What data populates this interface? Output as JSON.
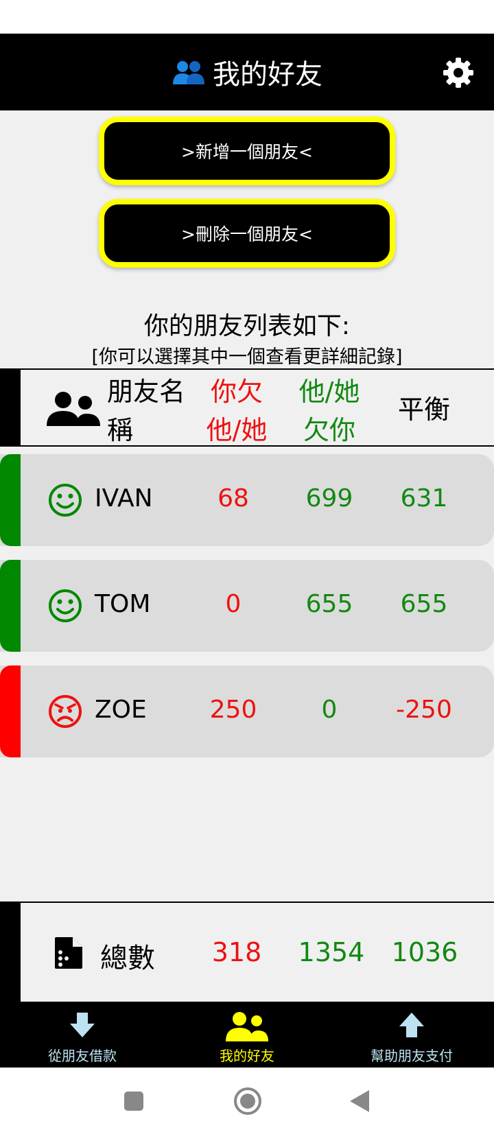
{
  "app_bar": {
    "title": "我的好友",
    "title_icon": "friends-icon",
    "settings_icon": "gear-icon"
  },
  "actions": {
    "add_friend": ">新增一個朋友<",
    "delete_friend": ">刪除一個朋友<"
  },
  "list": {
    "title": "你的朋友列表如下:",
    "subtitle": "[你可以選擇其中一個查看更詳細記錄]"
  },
  "table_header": {
    "name": "朋友名稱",
    "you_owe": "你欠他/她",
    "they_owe": "他/她欠你",
    "balance": "平衡"
  },
  "friends": [
    {
      "name": "IVAN",
      "you_owe": "68",
      "they_owe": "699",
      "balance": "631",
      "status": "positive",
      "face_icon": "smile-icon",
      "accent": "#008800"
    },
    {
      "name": "TOM",
      "you_owe": "0",
      "they_owe": "655",
      "balance": "655",
      "status": "positive",
      "face_icon": "smile-icon",
      "accent": "#008800"
    },
    {
      "name": "ZOE",
      "you_owe": "250",
      "they_owe": "0",
      "balance": "-250",
      "status": "negative",
      "face_icon": "angry-face-icon",
      "accent": "#ff0000"
    }
  ],
  "totals": {
    "label": "總數",
    "you_owe": "318",
    "they_owe": "1354",
    "balance": "1036",
    "icon": "document-icon"
  },
  "bottom_nav": [
    {
      "label": "從朋友借款",
      "icon": "arrow-down-icon",
      "active": false
    },
    {
      "label": "我的好友",
      "icon": "friends-icon",
      "active": true
    },
    {
      "label": "幫助朋友支付",
      "icon": "arrow-up-icon",
      "active": false
    }
  ],
  "colors": {
    "owe": "#ee1111",
    "owed": "#118811",
    "highlight": "#ffff00",
    "nav_label": "#bde3f2"
  }
}
